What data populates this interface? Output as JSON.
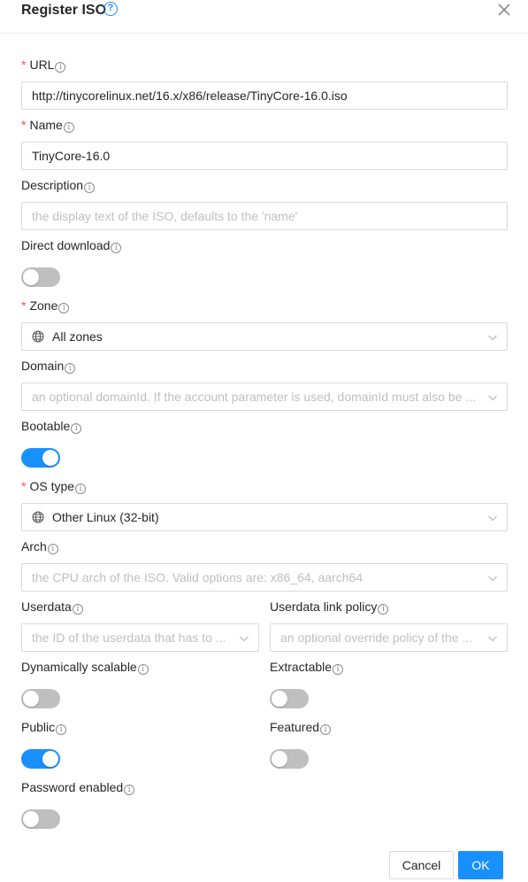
{
  "dialog": {
    "title": "Register ISO",
    "help_icon": "question-circle-icon",
    "close_icon": "close-icon"
  },
  "fields": {
    "url": {
      "label": "URL",
      "required": true,
      "value": "http://tinycorelinux.net/16.x/x86/release/TinyCore-16.0.iso"
    },
    "name": {
      "label": "Name",
      "required": true,
      "value": "TinyCore-16.0"
    },
    "description": {
      "label": "Description",
      "placeholder": "the display text of the ISO, defaults to the 'name'"
    },
    "direct_download": {
      "label": "Direct download",
      "on": false
    },
    "zone": {
      "label": "Zone",
      "required": true,
      "value": "All zones",
      "icon": "globe-icon"
    },
    "domain": {
      "label": "Domain",
      "placeholder": "an optional domainId. If the account parameter is used, domainId must also be ..."
    },
    "bootable": {
      "label": "Bootable",
      "on": true
    },
    "os_type": {
      "label": "OS type",
      "required": true,
      "value": "Other Linux (32-bit)",
      "icon": "globe-icon"
    },
    "arch": {
      "label": "Arch",
      "placeholder": "the CPU arch of the ISO. Valid options are: x86_64, aarch64"
    },
    "userdata": {
      "label": "Userdata",
      "placeholder": "the ID of the userdata that has to ..."
    },
    "userdata_link_policy": {
      "label": "Userdata link policy",
      "placeholder": "an optional override policy of the ..."
    },
    "dynamically_scalable": {
      "label": "Dynamically scalable",
      "on": false
    },
    "extractable": {
      "label": "Extractable",
      "on": false
    },
    "public": {
      "label": "Public",
      "on": true
    },
    "featured": {
      "label": "Featured",
      "on": false
    },
    "password_enabled": {
      "label": "Password enabled",
      "on": false
    }
  },
  "footer": {
    "cancel_label": "Cancel",
    "ok_label": "OK"
  },
  "colors": {
    "primary": "#1890ff",
    "required": "#ff4d4f",
    "switch_off": "#bfbfbf"
  },
  "info_glyph": "i"
}
